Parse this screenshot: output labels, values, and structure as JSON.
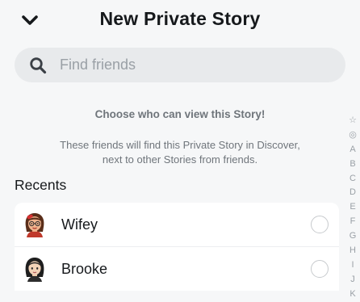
{
  "header": {
    "title": "New Private Story"
  },
  "search": {
    "placeholder": "Find friends"
  },
  "info": {
    "line1": "Choose who can view this Story!",
    "line2a": "These friends will find this Private Story in Discover,",
    "line2b": "next to other Stories from friends."
  },
  "recents_label": "Recents",
  "friends": [
    {
      "name": "Wifey",
      "selected": false
    },
    {
      "name": "Brooke",
      "selected": false
    }
  ],
  "alphabet_index": [
    "☆",
    "◎",
    "A",
    "B",
    "C",
    "D",
    "E",
    "F",
    "G",
    "H",
    "I",
    "J",
    "K"
  ],
  "icons": {
    "back": "chevron-down-icon",
    "search": "search-icon"
  },
  "colors": {
    "background": "#f6f7f8",
    "search_bg": "#e8eaec",
    "muted_text": "#6f757b"
  }
}
